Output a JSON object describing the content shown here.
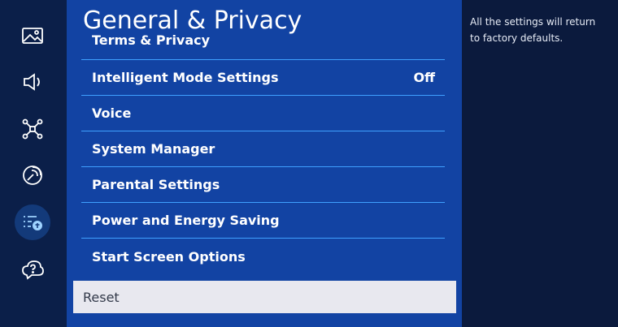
{
  "sidebar": {
    "items": [
      {
        "icon": "picture-icon"
      },
      {
        "icon": "sound-icon"
      },
      {
        "icon": "connection-icon"
      },
      {
        "icon": "broadcasting-icon"
      },
      {
        "icon": "general-privacy-icon",
        "active": true
      },
      {
        "icon": "support-icon"
      }
    ],
    "active_bg": "#133a7a"
  },
  "panel": {
    "title": "General & Privacy",
    "items": [
      {
        "label": "Terms & Privacy",
        "value": ""
      },
      {
        "label": "Intelligent Mode Settings",
        "value": "Off"
      },
      {
        "label": "Voice",
        "value": ""
      },
      {
        "label": "System Manager",
        "value": ""
      },
      {
        "label": "Parental Settings",
        "value": ""
      },
      {
        "label": "Power and Energy Saving",
        "value": ""
      },
      {
        "label": "Start Screen Options",
        "value": ""
      }
    ],
    "focused_item": "Reset"
  },
  "help": {
    "text": "All the settings will return to factory defaults."
  },
  "colors": {
    "panel_bg": "#1243a3",
    "divider": "#3fa0ff",
    "focus_bg": "#e8e8ef"
  }
}
